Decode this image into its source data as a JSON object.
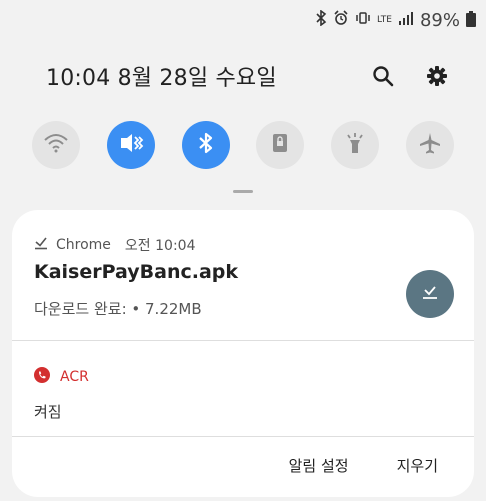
{
  "status": {
    "battery": "89%",
    "icons": [
      "bluetooth-icon",
      "alarm-icon",
      "vibrate-icon",
      "lte-icon",
      "signal-icon",
      "battery-icon"
    ],
    "network": "LTE"
  },
  "header": {
    "datetime": "10:04  8월 28일 수요일",
    "icons": [
      "search-icon",
      "settings-icon"
    ]
  },
  "quick_toggles": [
    {
      "name": "wifi",
      "state": "off",
      "icon": "wifi-icon"
    },
    {
      "name": "vibrate",
      "state": "on",
      "icon": "vibrate-icon"
    },
    {
      "name": "bluetooth",
      "state": "on",
      "icon": "bluetooth-icon"
    },
    {
      "name": "screen-lock",
      "state": "off",
      "icon": "lock-screen-icon"
    },
    {
      "name": "flashlight",
      "state": "off",
      "icon": "flashlight-icon"
    },
    {
      "name": "airplane",
      "state": "off",
      "icon": "airplane-icon"
    }
  ],
  "notification_download": {
    "app": "Chrome",
    "time": "오전 10:04",
    "title": "KaiserPayBanc.apk",
    "subtitle": "다운로드 완료: • 7.22MB"
  },
  "notification_acr": {
    "app": "ACR",
    "text": "켜짐"
  },
  "actions": {
    "settings": "알림 설정",
    "clear": "지우기"
  },
  "colors": {
    "accent_blue": "#3b8ff3",
    "toggle_off": "#e4e4e4",
    "download_button": "#5b7683",
    "acr_red": "#d32f2f"
  }
}
